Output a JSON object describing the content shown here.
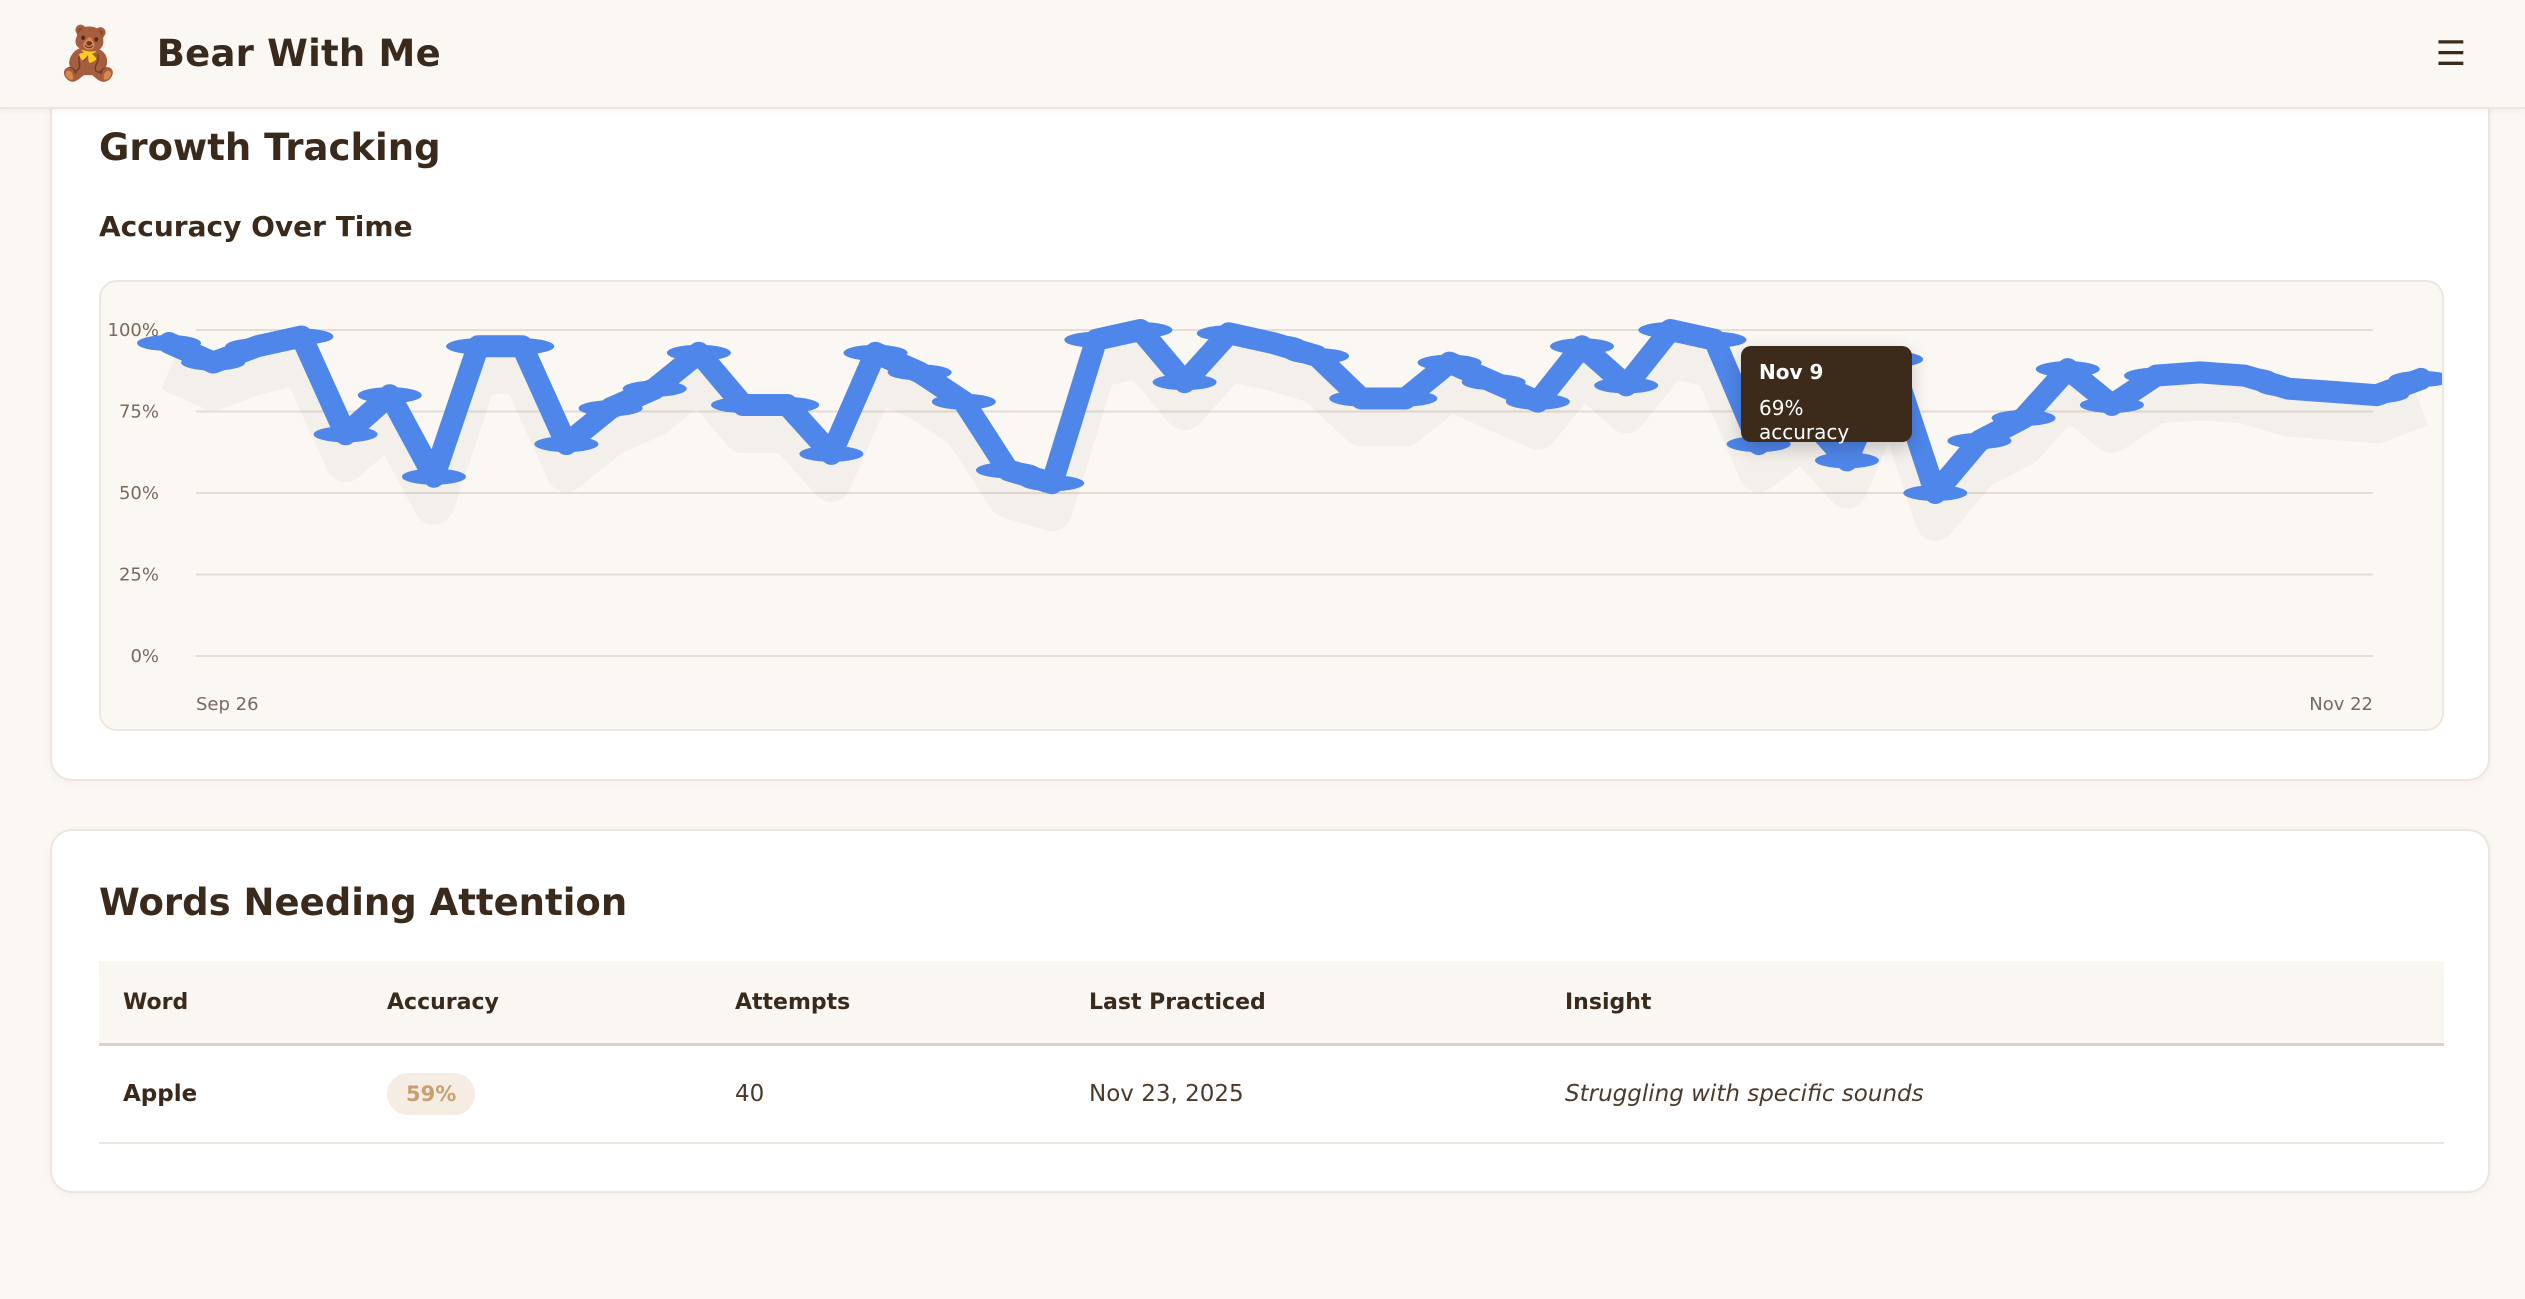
{
  "header": {
    "logo_glyph": "🧸",
    "title": "Bear With Me",
    "menu_glyph": "☰"
  },
  "growth": {
    "title": "Growth Tracking",
    "subtitle": "Accuracy Over Time"
  },
  "chart_data": {
    "type": "line",
    "series_color": "#4f86ea",
    "yticks": [
      "0%",
      "25%",
      "50%",
      "75%",
      "100%"
    ],
    "ylim": [
      0,
      100
    ],
    "x_start_label": "Sep 26",
    "x_end_label": "Nov 22",
    "grid": true,
    "values": [
      96,
      90,
      95,
      98,
      68,
      80,
      55,
      95,
      95,
      65,
      76,
      82,
      93,
      77,
      77,
      62,
      93,
      87,
      78,
      57,
      53,
      97,
      100,
      84,
      99,
      96,
      92,
      79,
      79,
      90,
      84,
      78,
      95,
      83,
      100,
      97,
      65,
      75,
      60,
      91,
      50,
      66,
      73,
      88,
      77,
      86,
      87,
      86,
      82,
      81,
      80,
      85
    ],
    "tooltip": {
      "date": "Nov 9",
      "value": "69% accuracy"
    }
  },
  "words": {
    "title": "Words Needing Attention",
    "columns": [
      "Word",
      "Accuracy",
      "Attempts",
      "Last Practiced",
      "Insight"
    ],
    "rows": [
      {
        "word": "Apple",
        "accuracy": "59%",
        "attempts": "40",
        "last_practiced": "Nov 23, 2025",
        "insight": "Struggling with specific sounds"
      }
    ]
  }
}
